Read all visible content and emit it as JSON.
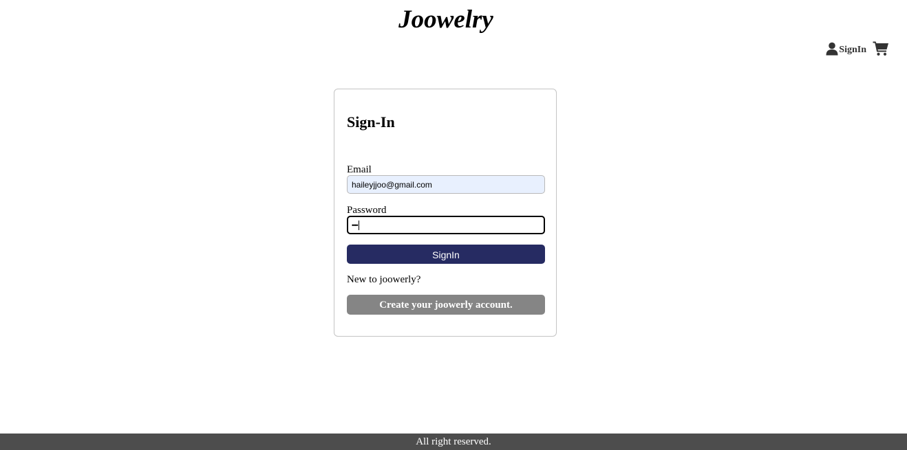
{
  "header": {
    "logo": "Joowelry",
    "nav": {
      "signin_label": "SignIn",
      "signin_icon": "user-icon",
      "cart_icon": "cart-icon"
    }
  },
  "signin_form": {
    "title": "Sign-In",
    "email_label": "Email",
    "email_value": "haileyjjoo@gmail.com",
    "password_label": "Password",
    "password_masked": "••••",
    "submit_label": "SignIn",
    "new_prompt": "New to joowerly?",
    "create_account_label": "Create your joowerly account."
  },
  "footer": {
    "text": "All right reserved."
  },
  "colors": {
    "primary_button": "#262b62",
    "secondary_button": "#858585",
    "footer_bg": "#4d4d4d",
    "autofill_bg": "#e8f0fe"
  }
}
